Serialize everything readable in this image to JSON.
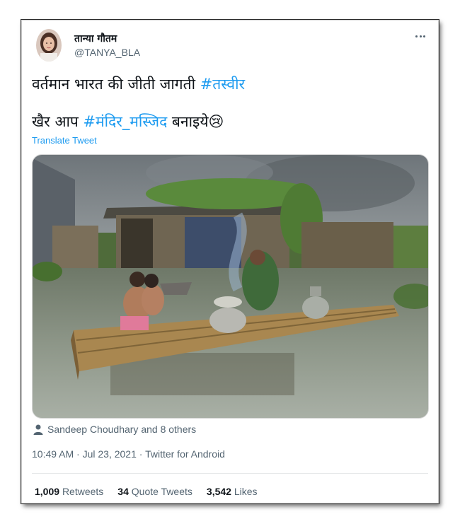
{
  "tweet": {
    "display_name": "तान्या गौतम",
    "handle": "@TANYA_BLA",
    "line1_text": "वर्तमान भारत की जीती जागती ",
    "line1_hashtag": "#तस्वीर",
    "line2_prefix": "खैर आप ",
    "line2_hashtag": "#मंदिर_मस्जिद",
    "line2_suffix": " बनाइये",
    "line2_emoji": "😢",
    "translate_label": "Translate Tweet",
    "tagged_users": "Sandeep Choudhary and 8 others",
    "timestamp": "10:49 AM · Jul 23, 2021 · Twitter for Android"
  },
  "stats": {
    "retweets_count": "1,009",
    "retweets_label": "Retweets",
    "quotes_count": "34",
    "quotes_label": "Quote Tweets",
    "likes_count": "3,542",
    "likes_label": "Likes"
  },
  "icons": {
    "more": "more-horizontal-icon",
    "tagged": "person-icon"
  },
  "colors": {
    "link": "#1d9bf0",
    "text": "#0f1419",
    "secondary": "#536471"
  }
}
